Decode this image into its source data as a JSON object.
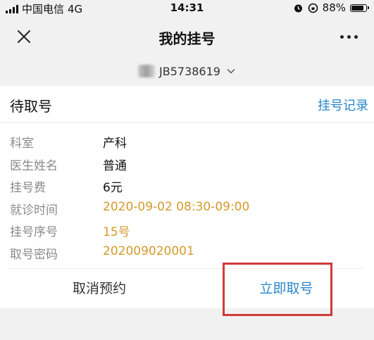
{
  "status_bar": {
    "carrier": "中国电信",
    "network": "4G",
    "time": "14:31",
    "battery": "88%",
    "battery_level": 0.88
  },
  "nav": {
    "title": "我的挂号",
    "close_icon": "close-icon",
    "more_icon": "more-icon"
  },
  "account": {
    "id": "JB5738619"
  },
  "card": {
    "status": "待取号",
    "history_link": "挂号记录",
    "fields": [
      {
        "label": "科室",
        "value": "产科"
      },
      {
        "label": "医生姓名",
        "value": "普通"
      },
      {
        "label": "挂号费",
        "value": "6元"
      },
      {
        "label": "就诊时间",
        "value": "2020-09-02 08:30-09:00"
      },
      {
        "label": "挂号序号",
        "value": "15号"
      },
      {
        "label": "取号密码",
        "value": "202009020001"
      }
    ],
    "cancel_label": "取消预约",
    "take_label": "立即取号"
  },
  "colors": {
    "link_blue": "#2a86c9",
    "highlight_orange": "#d49a2a",
    "annotation_red": "#d13a3a"
  }
}
